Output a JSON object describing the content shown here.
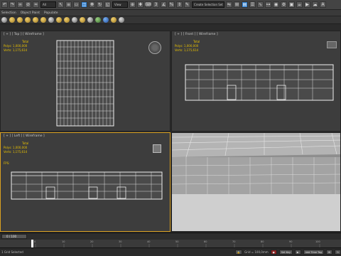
{
  "toolbar": {
    "selection_filter": "All",
    "view_combo": "View",
    "named_selection": "Create Selection Set"
  },
  "menubar": {
    "items": [
      "Selection",
      "Object Paint",
      "Populate"
    ]
  },
  "viewports": {
    "top": {
      "label": "[ + ] [ Top ] [ Wireframe ]"
    },
    "front": {
      "label": "[ + ] [ Front ] [ Wireframe ]"
    },
    "left": {
      "label": "[ + ] [ Left ] [ Wireframe ]"
    },
    "persp": {
      "label": ""
    }
  },
  "stats": {
    "header": "Total",
    "polys_label": "Polys:",
    "polys_value": "1,000,000",
    "verts_label": "Verts:",
    "verts_value": "1,175,614",
    "fps_label": "FPS:"
  },
  "timeline": {
    "frame_counter": "0 / 100",
    "ticks": [
      "0",
      "10",
      "20",
      "30",
      "40",
      "50",
      "60",
      "70",
      "80",
      "90",
      "100"
    ]
  },
  "statusbar": {
    "message": "1 Grid Selected",
    "grid": "Grid = 100,0mm",
    "add_time_tag": "Add Time Tag",
    "set_key": "Set Key"
  },
  "icons": {
    "select": "arrow-icon",
    "move": "move-icon",
    "rotate": "rotate-icon",
    "scale": "scale-icon"
  }
}
